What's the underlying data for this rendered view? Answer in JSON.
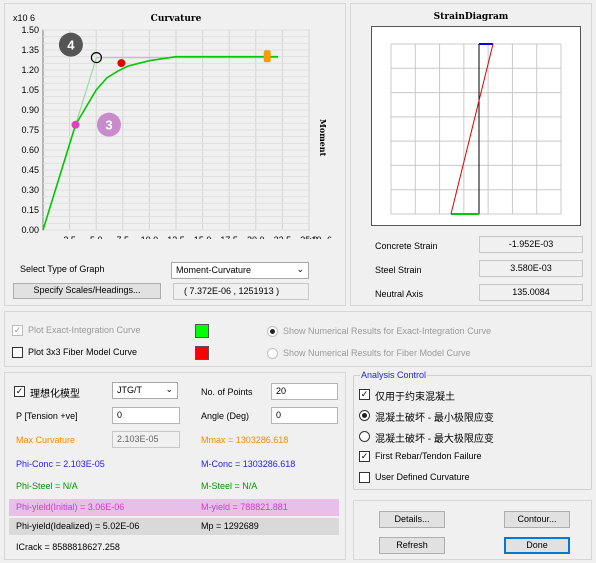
{
  "curvature_panel": {
    "title": "Curvature",
    "side_label": "Moment",
    "y_exponent": "x10 6",
    "x_exponent": "x10 -6",
    "select_graph_label": "Select Type of Graph",
    "graph_type": "Moment-Curvature",
    "specify_button": "Specify Scales/Headings...",
    "coordinate_readout": "( 7.372E-06 , 1251913 )",
    "marker_3_label": "3",
    "marker_4_label": "4"
  },
  "chart_data": {
    "type": "line",
    "title": "Curvature",
    "xlabel": "",
    "ylabel": "Moment",
    "x_tick_labels": [
      "2.5",
      "5.0",
      "7.5",
      "10.0",
      "12.5",
      "15.0",
      "17.5",
      "20.0",
      "22.5",
      "25.0"
    ],
    "y_tick_labels": [
      "1.50",
      "1.45",
      "1.40",
      "1.35",
      "1.30",
      "1.25",
      "1.20",
      "1.15",
      "1.10",
      "1.05",
      "1.00",
      "0.95",
      "0.90",
      "0.85",
      "0.80",
      "0.75",
      "0.70",
      "0.65",
      "0.60",
      "0.55",
      "0.50",
      "0.45",
      "0.40",
      "0.35",
      "0.30",
      "0.25",
      "0.20",
      "0.15",
      "0.10",
      "0.05",
      "0.00"
    ],
    "xlim": [
      0,
      25
    ],
    "ylim": [
      0,
      1.5
    ],
    "grid": true,
    "series": [
      {
        "color": "#00c800",
        "x": [
          0,
          3.06,
          5.0,
          6.0,
          7.0,
          8.0,
          10.0,
          12.5,
          15.0,
          17.5,
          20.0,
          22.1
        ],
        "y": [
          0,
          0.789,
          1.05,
          1.14,
          1.19,
          1.23,
          1.27,
          1.3,
          1.3,
          1.3,
          1.3,
          1.3
        ]
      },
      {
        "color": "#a0d8a0",
        "x": [
          0,
          3.06,
          5.02,
          13.5,
          22.1
        ],
        "y": [
          0,
          0.789,
          1.293,
          1.293,
          1.293
        ]
      }
    ],
    "markers": [
      {
        "label": "phi-yield initial",
        "x": 3.06,
        "y": 0.789,
        "color": "#e040c0"
      },
      {
        "label": "phi-yield idealized",
        "x": 5.02,
        "y": 1.293,
        "color": "#000000"
      },
      {
        "label": "current point",
        "x": 7.37,
        "y": 1.252,
        "color": "#e00000"
      },
      {
        "label": "max curvature",
        "x": 21.03,
        "y": 1.303,
        "color": "#f0a000"
      }
    ]
  },
  "strain_panel": {
    "title": "StrainDiagram",
    "concrete_strain_label": "Concrete Strain",
    "concrete_strain": "-1.952E-03",
    "steel_strain_label": "Steel Strain",
    "steel_strain": "3.580E-03",
    "neutral_axis_label": "Neutral Axis",
    "neutral_axis": "135.0084"
  },
  "options": {
    "plot_exact_label": "Plot Exact-Integration Curve",
    "plot_exact_color": "#00ff00",
    "plot_fiber_label": "Plot 3x3 Fiber Model Curve",
    "plot_fiber_color": "#ff0000",
    "show_exact_label": "Show Numerical Results for Exact-Integration Curve",
    "show_fiber_label": "Show Numerical Results for Fiber Model Curve"
  },
  "results": {
    "idealize_label": "理想化模型",
    "model_value": "JTG/T",
    "no_points_label": "No. of Points",
    "no_points_value": "20",
    "p_label": "P [Tension +ve]",
    "p_value": "0",
    "angle_label": "Angle (Deg)",
    "angle_value": "0",
    "max_curvature_label": "Max Curvature",
    "max_curvature_value": "2.103E-05",
    "mmax": "Mmax = 1303286.618",
    "phi_conc": "Phi-Conc = 2.103E-05",
    "m_conc": "M-Conc = 1303286.618",
    "phi_steel": "Phi-Steel = N/A",
    "m_steel": "M-Steel = N/A",
    "phi_yield_initial": "Phi-yield(Initial) = 3.06E-06",
    "m_yield": "M-yield = 788821.881",
    "phi_yield_idealized": "Phi-yield(Idealized) = 5.02E-06",
    "mp": "Mp = 1292689",
    "icrack": "ICrack =  8588818627.258"
  },
  "analysis_control": {
    "title": "Analysis Control",
    "confined_label": "仅用于约束混凝土",
    "radio_min_label": "混凝土破坏 - 最小极限应变",
    "radio_max_label": "混凝土破坏 - 最大极限应变",
    "first_rebar_label": "First Rebar/Tendon Failure",
    "user_defined_label": "User Defined Curvature"
  },
  "buttons": {
    "details": "Details...",
    "contour": "Contour...",
    "refresh": "Refresh",
    "done": "Done"
  }
}
